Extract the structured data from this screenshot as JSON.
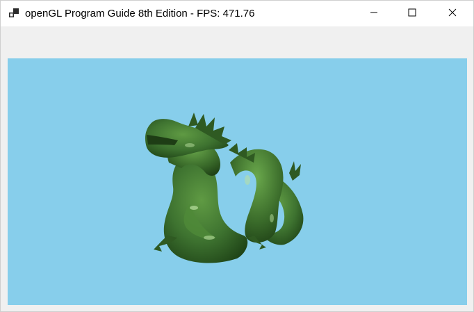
{
  "window": {
    "title": "openGL Program Guide 8th Edition - FPS: 471.76",
    "app_icon": "app-window-icon",
    "controls": {
      "minimize": "minimize-icon",
      "maximize": "maximize-icon",
      "close": "close-icon"
    }
  },
  "viewport": {
    "background_color": "#87ceeb",
    "model": "dragon",
    "model_color": "#3a6b2a"
  }
}
